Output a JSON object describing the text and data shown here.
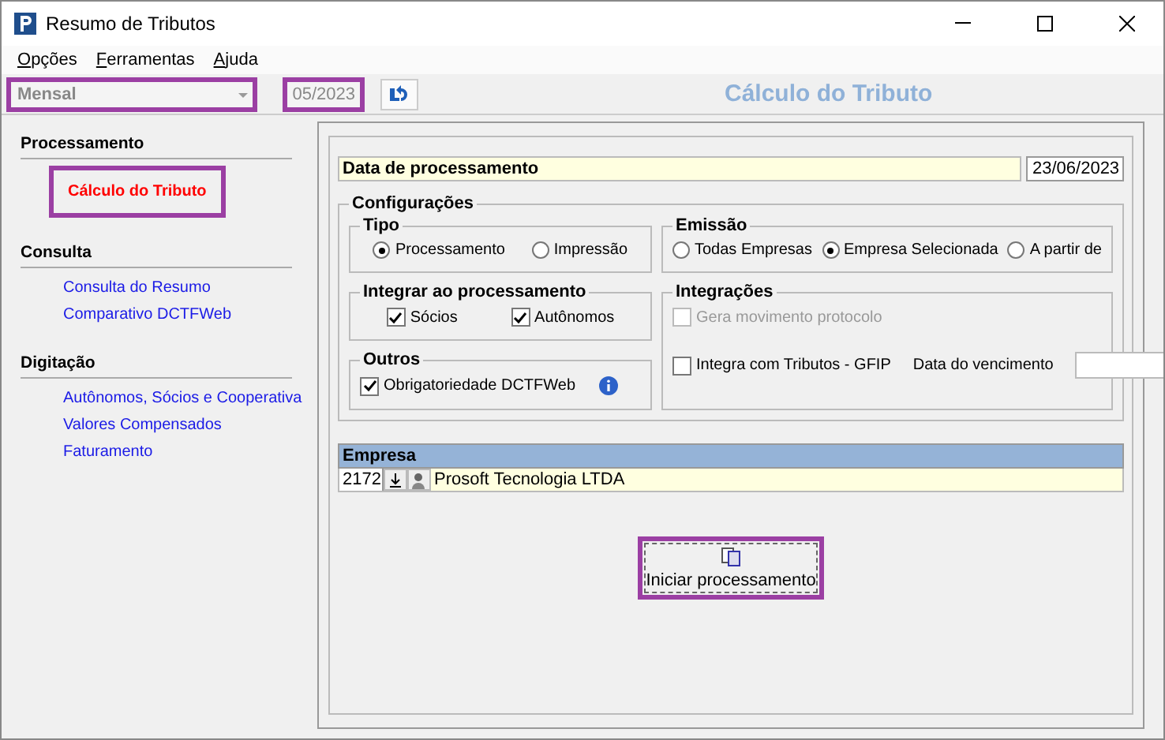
{
  "window": {
    "title": "Resumo de Tributos"
  },
  "menu": [
    {
      "label": "Opções"
    },
    {
      "label": "Ferramentas"
    },
    {
      "label": "Ajuda"
    }
  ],
  "toolbar": {
    "period": {
      "value": "Mensal",
      "highlighted": true
    },
    "month": {
      "value": "05/2023",
      "highlighted": true
    }
  },
  "panel_title": "Cálculo do Tributo",
  "sidebar": [
    {
      "title": "Processamento",
      "items": [
        {
          "label": "Cálculo do Tributo",
          "selected": true,
          "highlighted": true
        }
      ]
    },
    {
      "title": "Consulta",
      "items": [
        {
          "label": "Consulta do Resumo",
          "selected": false,
          "highlighted": false
        },
        {
          "label": "Comparativo DCTFWeb",
          "selected": false,
          "highlighted": false
        }
      ]
    },
    {
      "title": "Digitação",
      "items": [
        {
          "label": "Autônomos, Sócios e Cooperativa",
          "selected": false,
          "highlighted": false
        },
        {
          "label": "Valores Compensados",
          "selected": false,
          "highlighted": false
        },
        {
          "label": "Faturamento",
          "selected": false,
          "highlighted": false
        }
      ]
    }
  ],
  "date": {
    "label": "Data de processamento",
    "value": "23/06/2023"
  },
  "config": {
    "title": "Configurações",
    "tipo": {
      "title": "Tipo",
      "options": [
        {
          "label": "Processamento",
          "selected": true
        },
        {
          "label": "Impressão",
          "selected": false
        }
      ]
    },
    "emissao": {
      "title": "Emissão",
      "options": [
        {
          "label": "Todas Empresas",
          "selected": false
        },
        {
          "label": "Empresa Selecionada",
          "selected": true
        },
        {
          "label": "A partir de",
          "selected": false
        }
      ]
    },
    "integrar": {
      "title": "Integrar ao processamento",
      "options": [
        {
          "label": "Sócios",
          "checked": true
        },
        {
          "label": "Autônomos",
          "checked": true
        }
      ]
    },
    "integracoes": {
      "title": "Integrações",
      "gera": {
        "label": "Gera movimento protocolo",
        "checked": false,
        "disabled": true
      },
      "gfip": {
        "label": "Integra com Tributos - GFIP",
        "checked": false,
        "disabled": false
      },
      "due_label": "Data do vencimento"
    },
    "outros": {
      "title": "Outros",
      "option": {
        "label": "Obrigatoriedade DCTFWeb",
        "checked": true,
        "disabled": false
      }
    }
  },
  "empresa": {
    "title": "Empresa",
    "code": "2172",
    "name": "Prosoft Tecnologia LTDA"
  },
  "start_button": {
    "label": "Iniciar processamento",
    "highlighted": true
  }
}
